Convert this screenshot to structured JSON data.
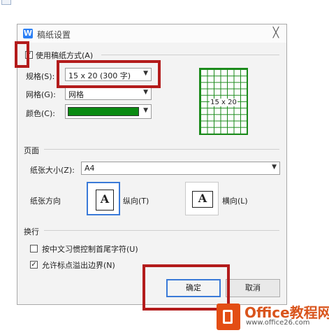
{
  "dialog": {
    "title": "稿纸设置",
    "app_icon_glyph": "W",
    "close_glyph": "╳"
  },
  "use_mode": {
    "label": "使用稿纸方式(A)",
    "checked": true
  },
  "spec": {
    "label": "规格(S):",
    "value": "15 x 20 (300 字)"
  },
  "grid_type": {
    "label": "网格(G):",
    "value": "网格"
  },
  "color": {
    "label": "颜色(C):",
    "value": "#0a8a12"
  },
  "preview": {
    "label": "15 x 20",
    "cols": 7,
    "rows": 10
  },
  "page_section": {
    "title": "页面",
    "paper_size_label": "纸张大小(Z):",
    "paper_size_value": "A4",
    "orientation_label": "纸张方向",
    "portrait": {
      "glyph": "A",
      "label": "纵向(T)",
      "selected": true
    },
    "landscape": {
      "glyph": "A",
      "label": "横向(L)",
      "selected": false
    }
  },
  "wrap_section": {
    "title": "换行",
    "opt1": {
      "label": "按中文习惯控制首尾字符(U)",
      "checked": false
    },
    "opt2": {
      "label": "允许标点溢出边界(N)",
      "checked": true
    }
  },
  "buttons": {
    "ok": "确定",
    "cancel": "取消"
  },
  "arrow_glyph": "▼",
  "check_glyph": "✓",
  "watermark": {
    "brand": "Office教程网",
    "url": "www.office26.com"
  },
  "highlight_color": "#b31b1b"
}
